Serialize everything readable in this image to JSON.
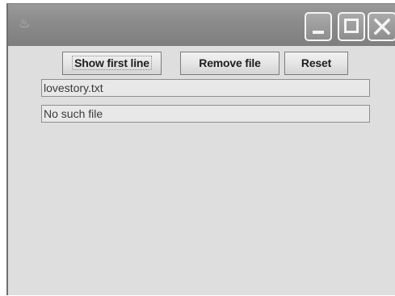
{
  "window": {
    "icon": "java-app-icon",
    "controls": {
      "minimize_icon": "minimize-icon",
      "maximize_icon": "maximize-icon",
      "close_icon": "close-icon"
    }
  },
  "toolbar": {
    "show_first_line_label": "Show first line",
    "remove_file_label": "Remove file",
    "reset_label": "Reset"
  },
  "fields": {
    "filename_value": "lovestory.txt",
    "status_value": "No such file"
  },
  "colors": {
    "titlebar": "#8c8c8c",
    "content_background": "#dedede",
    "field_background": "#e8e8e8"
  }
}
